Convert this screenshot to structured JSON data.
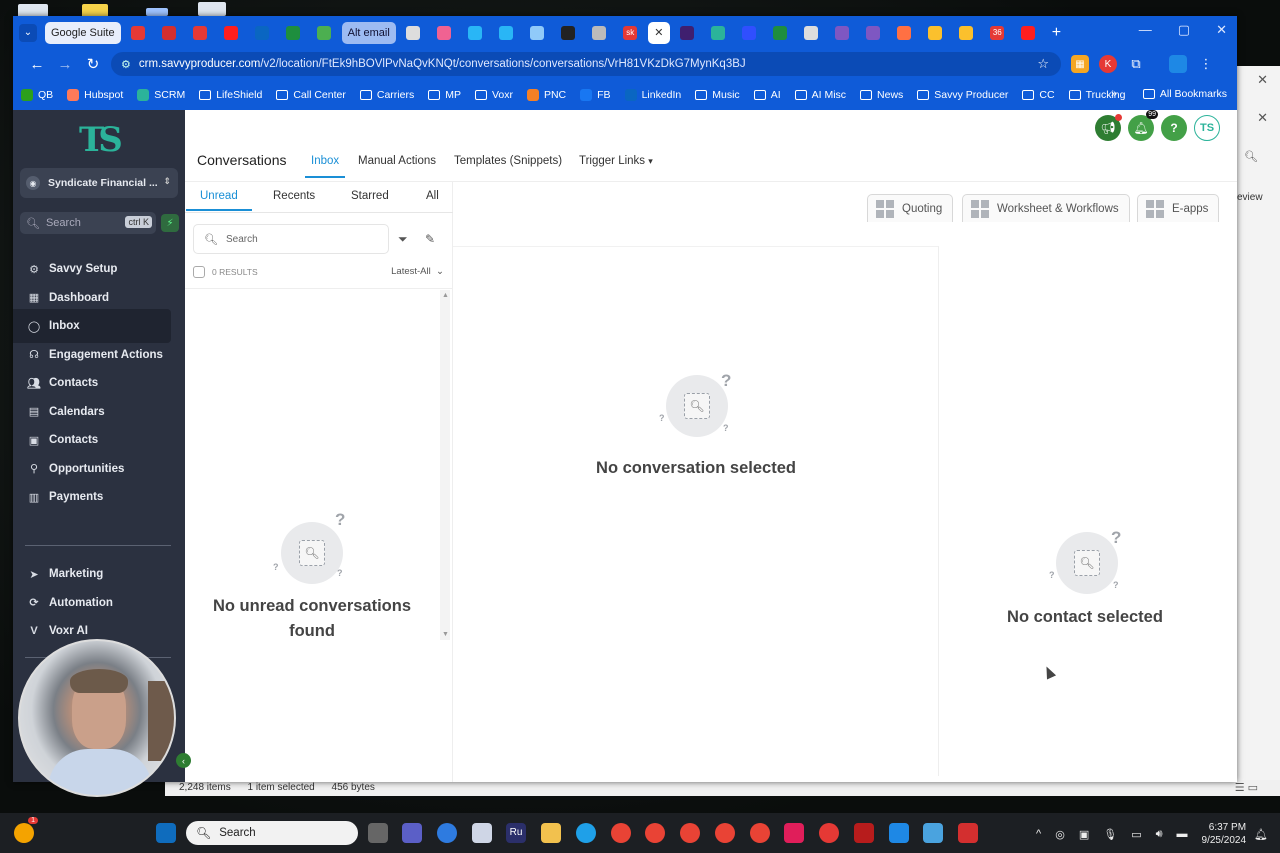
{
  "browser": {
    "tabs": [
      {
        "label": "Google Suite",
        "type": "pill",
        "color": "#e8eefb"
      },
      {
        "label": "",
        "icon": "gmail-icon",
        "color": "#e53935"
      },
      {
        "label": "",
        "icon": "acrobat-icon",
        "color": "#d32f2f"
      },
      {
        "label": "",
        "icon": "gmail-icon",
        "color": "#e53935"
      },
      {
        "label": "",
        "icon": "youtube-icon",
        "color": "#ff1e1e"
      },
      {
        "label": "",
        "icon": "linkedin-icon",
        "color": "#0a66c2"
      },
      {
        "label": "",
        "icon": "sheets-icon",
        "color": "#1e8e3e"
      },
      {
        "label": "",
        "icon": "image-icon",
        "color": "#4caf50"
      },
      {
        "label": "Alt email",
        "type": "pill2",
        "color": "#9dbbf2"
      },
      {
        "label": "",
        "icon": "chatgpt-icon",
        "color": "#dddddd"
      },
      {
        "label": "",
        "icon": "tool-icon",
        "color": "#f06292"
      },
      {
        "label": "",
        "icon": "sync-icon",
        "color": "#29b6f6"
      },
      {
        "label": "",
        "icon": "sync-icon",
        "color": "#29b6f6"
      },
      {
        "label": "",
        "icon": "document-icon",
        "color": "#90caf9"
      },
      {
        "label": "",
        "icon": "nike-icon",
        "color": "#222222"
      },
      {
        "label": "",
        "icon": "clock-icon",
        "color": "#bbbbbb"
      },
      {
        "label": "sk",
        "icon": "sk-icon",
        "color": "#e53935"
      },
      {
        "label": "",
        "icon": "close-icon",
        "color": "#ffffff",
        "active": true
      },
      {
        "label": "",
        "icon": "app-icon",
        "color": "#3f1f6f"
      },
      {
        "label": "",
        "icon": "savvy-icon",
        "color": "#2bb39a"
      },
      {
        "label": "",
        "icon": "triangle-icon",
        "color": "#304ffe"
      },
      {
        "label": "",
        "icon": "sheets-icon",
        "color": "#1e8e3e"
      },
      {
        "label": "",
        "icon": "globe-icon",
        "color": "#dddddd"
      },
      {
        "label": "",
        "icon": "v-icon",
        "color": "#7e57c2"
      },
      {
        "label": "",
        "icon": "v-icon",
        "color": "#7e57c2"
      },
      {
        "label": "",
        "icon": "hand-icon",
        "color": "#ff7043"
      },
      {
        "label": "",
        "icon": "drive-icon",
        "color": "#fbc02d"
      },
      {
        "label": "",
        "icon": "drive-icon",
        "color": "#fbc02d"
      },
      {
        "label": "36",
        "icon": "badge-icon",
        "color": "#e53935"
      },
      {
        "label": "",
        "icon": "youtube-icon",
        "color": "#ff1e1e"
      }
    ],
    "url_host": "crm.savvyproducer.com",
    "url_path": "/v2/location/FtEk9hBOVlPvNaQvKNQt/conversations/conversations/VrH81VKzDkG7MynKq3BJ",
    "bookmarks": [
      {
        "label": "QB",
        "color": "#2ca01c"
      },
      {
        "label": "Hubspot",
        "color": "#ff7a59"
      },
      {
        "label": "SCRM",
        "color": "#2bb39a"
      },
      {
        "label": "LifeShield",
        "folder": true
      },
      {
        "label": "Call Center",
        "folder": true
      },
      {
        "label": "Carriers",
        "folder": true
      },
      {
        "label": "MP",
        "folder": true
      },
      {
        "label": "Voxr",
        "folder": true
      },
      {
        "label": "PNC",
        "color": "#f58025"
      },
      {
        "label": "FB",
        "color": "#1877f2"
      },
      {
        "label": "LinkedIn",
        "color": "#0a66c2"
      },
      {
        "label": "Music",
        "folder": true
      },
      {
        "label": "AI",
        "folder": true
      },
      {
        "label": "AI Misc",
        "folder": true
      },
      {
        "label": "News",
        "folder": true
      },
      {
        "label": "Savvy Producer",
        "folder": true
      },
      {
        "label": "CC",
        "folder": true
      },
      {
        "label": "Trucking",
        "folder": true
      }
    ],
    "bookmarks_more": "»",
    "all_bookmarks": "All Bookmarks"
  },
  "sidebar": {
    "account": "Syndicate Financial ...",
    "search_placeholder": "Search",
    "search_shortcut": "ctrl K",
    "items": [
      {
        "label": "Savvy Setup",
        "icon": "gear-icon"
      },
      {
        "label": "Dashboard",
        "icon": "dashboard-icon"
      },
      {
        "label": "Inbox",
        "icon": "chat-icon",
        "active": true
      },
      {
        "label": "Engagement Actions",
        "icon": "headset-icon"
      },
      {
        "label": "Contacts",
        "icon": "users-icon"
      },
      {
        "label": "Calendars",
        "icon": "calendar-icon"
      },
      {
        "label": "Contacts",
        "icon": "contact-card-icon"
      },
      {
        "label": "Opportunities",
        "icon": "funnel-icon"
      },
      {
        "label": "Payments",
        "icon": "receipt-icon"
      }
    ],
    "items2": [
      {
        "label": "Marketing",
        "icon": "send-icon"
      },
      {
        "label": "Automation",
        "icon": "automation-icon"
      },
      {
        "label": "Voxr AI",
        "icon": "voxr-icon"
      }
    ]
  },
  "topnav": {
    "title": "Conversations",
    "items": [
      "Inbox",
      "Manual Actions",
      "Templates (Snippets)",
      "Trigger Links"
    ],
    "notification_count": "99"
  },
  "convlist": {
    "tabs": [
      "Unread",
      "Recents",
      "Starred",
      "All"
    ],
    "search_placeholder": "Search",
    "results": "0 RESULTS",
    "sort": "Latest-All",
    "empty": "No unread conversations found"
  },
  "panel_tabs": [
    "Quoting",
    "Worksheet & Workflows",
    "E-apps"
  ],
  "conversation": {
    "empty": "No conversation selected"
  },
  "contact": {
    "empty": "No contact selected"
  },
  "statusline": {
    "items": "2,248 items",
    "selected": "1 item selected",
    "size": "456 bytes"
  },
  "taskbar": {
    "search_placeholder": "Search",
    "notify_count": "1",
    "time": "6:37 PM",
    "date": "9/25/2024"
  }
}
